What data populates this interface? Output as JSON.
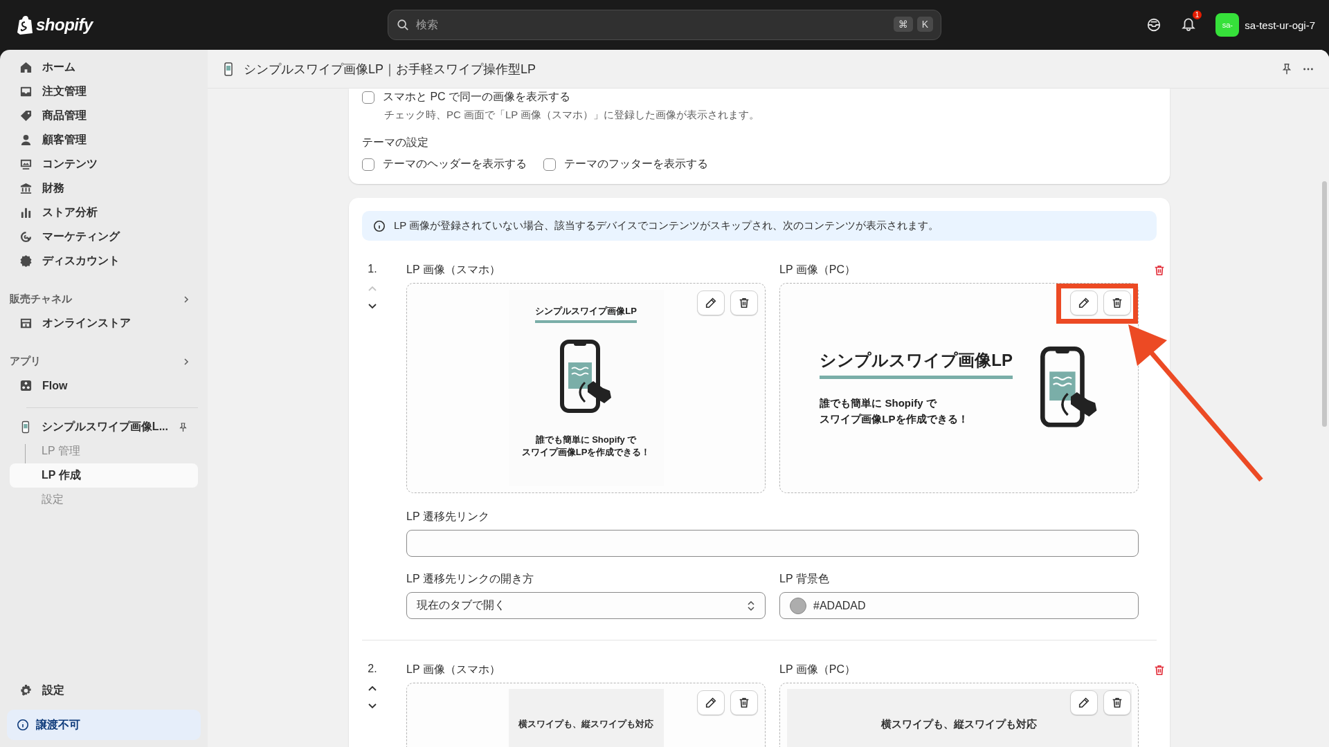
{
  "topbar": {
    "logo": "shopify",
    "search": {
      "placeholder": "検索",
      "keys": [
        "⌘",
        "K"
      ]
    },
    "notifications": "1",
    "store": {
      "avatar": "sa-",
      "name": "sa-test-ur-ogi-7"
    }
  },
  "sidebar": {
    "items": [
      {
        "label": "ホーム"
      },
      {
        "label": "注文管理"
      },
      {
        "label": "商品管理"
      },
      {
        "label": "顧客管理"
      },
      {
        "label": "コンテンツ"
      },
      {
        "label": "財務"
      },
      {
        "label": "ストア分析"
      },
      {
        "label": "マーケティング"
      },
      {
        "label": "ディスカウント"
      }
    ],
    "sections": [
      {
        "title": "販売チャネル",
        "items": [
          {
            "label": "オンラインストア"
          }
        ]
      },
      {
        "title": "アプリ",
        "items": [
          {
            "label": "Flow"
          }
        ]
      }
    ],
    "app": {
      "name": "シンプルスワイプ画像L...",
      "subitems": [
        {
          "label": "LP 管理",
          "selected": false
        },
        {
          "label": "LP 作成",
          "selected": true
        },
        {
          "label": "設定",
          "selected": false
        }
      ]
    },
    "footer": [
      {
        "label": "設定"
      }
    ],
    "notice": "譲渡不可"
  },
  "page": {
    "title": "シンプルスワイプ画像LP｜お手軽スワイプ操作型LP"
  },
  "display_settings": {
    "same_image": {
      "label": "スマホと PC で同一の画像を表示する",
      "checked": false,
      "help": "チェック時、PC 画面で「LP 画像（スマホ）」に登録した画像が表示されます。"
    },
    "theme_title": "テーマの設定",
    "theme_options": [
      {
        "label": "テーマのヘッダーを表示する",
        "checked": false
      },
      {
        "label": "テーマのフッターを表示する",
        "checked": false
      }
    ]
  },
  "lp_card": {
    "notice": "LP 画像が登録されていない場合、該当するデバイスでコンテンツがスキップされ、次のコンテンツが表示されます。",
    "entries": [
      {
        "number": "1.",
        "can_move_up": false,
        "can_move_down": true,
        "images": [
          {
            "label": "LP 画像（スマホ）",
            "kind": "hero",
            "title": "シンプルスワイプ画像LP",
            "caption": [
              "誰でも簡単に Shopify で",
              "スワイプ画像LPを作成できる！"
            ],
            "highlighted": false
          },
          {
            "label": "LP 画像（PC）",
            "kind": "hero",
            "title": "シンプルスワイプ画像LP",
            "caption": [
              "誰でも簡単に Shopify で",
              "スワイプ画像LPを作成できる！"
            ],
            "highlighted": true
          }
        ],
        "link": {
          "label": "LP 遷移先リンク"
        },
        "open_mode": {
          "label": "LP 遷移先リンクの開き方",
          "value": "現在のタブで開く"
        },
        "background": {
          "label": "LP 背景色",
          "value": "#ADADAD",
          "color": "#adadad"
        }
      },
      {
        "number": "2.",
        "can_move_up": true,
        "can_move_down": true,
        "images": [
          {
            "label": "LP 画像（スマホ）",
            "kind": "banner",
            "title": "横スワイプも、縦スワイプも対応",
            "highlighted": false
          },
          {
            "label": "LP 画像（PC）",
            "kind": "banner",
            "title": "横スワイプも、縦スワイプも対応",
            "highlighted": false
          }
        ]
      }
    ]
  }
}
